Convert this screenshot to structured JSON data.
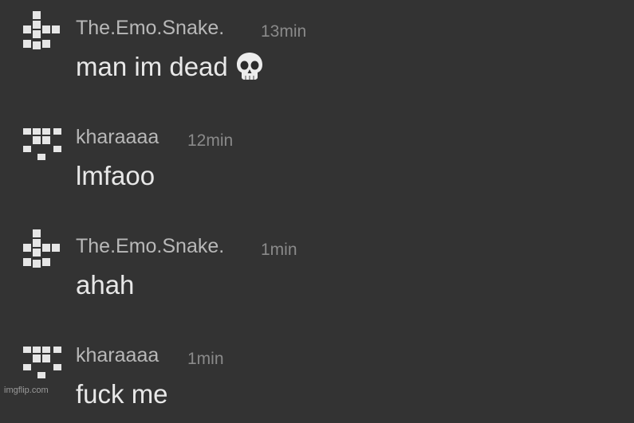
{
  "messages": [
    {
      "author": "The.Emo.Snake.",
      "time": "13min",
      "text": "man im dead",
      "emoji": "skull-emoji",
      "avatar": "pixel-identicon-snake"
    },
    {
      "author": "kharaaaa",
      "time": "12min",
      "text": "lmfaoo",
      "avatar": "pixel-identicon-kharaaaa"
    },
    {
      "author": "The.Emo.Snake.",
      "time": "1min",
      "text": "ahah",
      "avatar": "pixel-identicon-snake"
    },
    {
      "author": "kharaaaa",
      "time": "1min",
      "text": "fuck me",
      "avatar": "pixel-identicon-kharaaaa"
    }
  ],
  "watermark": "imgflip.com",
  "colors": {
    "background": "#333333",
    "author": "#b8b8b8",
    "timestamp": "#8a8a8a",
    "message_text": "#e8e8e8",
    "avatar": "#e6e6e6"
  }
}
